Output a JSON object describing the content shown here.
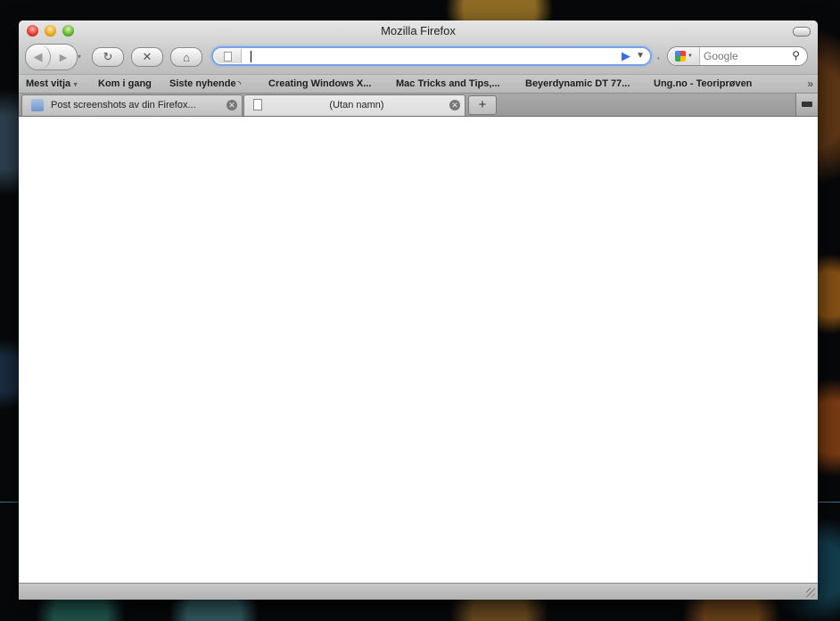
{
  "window": {
    "title": "Mozilla Firefox"
  },
  "toolbar": {
    "back_glyph": "◀",
    "forward_glyph": "▶",
    "history_glyph": "▾",
    "reload_glyph": "↻",
    "stop_glyph": "✕",
    "home_glyph": "⌂",
    "url_value": "",
    "go_glyph": "▶",
    "url_dropdown_glyph": "▼",
    "search_engine_icon": "google-icon",
    "search_placeholder": "Google",
    "search_glyph": "⚲"
  },
  "bookmarks": {
    "items": [
      {
        "label": "Mest vitja",
        "has_dropdown": true
      },
      {
        "label": "Kom i gang"
      },
      {
        "label": "Siste nyhende",
        "feed_icon": "rss-icon"
      },
      {
        "label": "Creating Windows X..."
      },
      {
        "label": "Mac Tricks and Tips,..."
      },
      {
        "label": "Beyerdynamic DT 77..."
      },
      {
        "label": "Ung.no - Teoriprøven"
      }
    ],
    "overflow_glyph": "»"
  },
  "tabs": [
    {
      "label": "Post screenshots av din Firefox...",
      "favicon": "firefox-icon",
      "active": false
    },
    {
      "label": "(Utan namn)",
      "favicon": "page-icon",
      "active": true
    }
  ],
  "newtab_glyph": "+",
  "colors": {
    "url_focus": "#79a3e6",
    "go_arrow": "#3b6fe0"
  }
}
